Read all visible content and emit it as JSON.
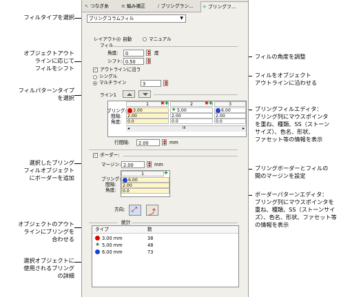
{
  "tabs": [
    {
      "label": "つなぎ糸",
      "icon": "connector-icon"
    },
    {
      "label": "編み補正",
      "icon": "compensation-icon"
    },
    {
      "label": "ブリングラン...",
      "icon": "bling-run-icon"
    },
    {
      "label": "ブリングフ...",
      "icon": "bling-fill-icon",
      "active": true
    }
  ],
  "fill_type": {
    "value": "ブリングコラムフィル"
  },
  "layout": {
    "label": "レイアウト:",
    "auto": "自動",
    "manual": "マニュアル",
    "selected": "auto"
  },
  "fill": {
    "section": "フィル",
    "angle_label": "角度:",
    "angle_value": "0",
    "angle_unit": "度",
    "shift_label": "シフト:",
    "shift_value": "0.50",
    "follow_outline": "アウトラインに沿う",
    "follow_outline_checked": true,
    "single": "シングル",
    "multi": "マルチライン",
    "multi_value": "3",
    "selected": "multi"
  },
  "line1": {
    "section": "ライン1",
    "cols": [
      "1",
      "2",
      "3"
    ],
    "row_labels": {
      "bling": "ブリング:",
      "spacing": "間隔:",
      "angle": "角度:"
    },
    "col1": {
      "bling": "3.00",
      "spacing": "2.00",
      "angle": "0.0"
    },
    "col2": {
      "bling": "5.00",
      "spacing": "2.00",
      "angle": "0.0"
    },
    "col3": {
      "bling": "6.00",
      "spacing": "2.00",
      "angle": "0.0"
    },
    "scroll_mid": "III",
    "row_spacing_label": "行間隔:",
    "row_spacing_value": "2.00",
    "row_spacing_unit": "mm"
  },
  "border": {
    "label": "ボーダー:",
    "checked": true,
    "margin_label": "マージン:",
    "margin_value": "2.00",
    "margin_unit": "mm",
    "col": "1",
    "row_labels": {
      "bling": "ブリング:",
      "spacing": "間隔:",
      "angle": "角度:"
    },
    "bling": "6.00",
    "spacing": "2.00",
    "angle": "0.0",
    "direction_label": "方向:"
  },
  "stats": {
    "section": "統計",
    "col_type": "タイプ",
    "col_count": "数",
    "rows": [
      {
        "type": "3.00 mm",
        "count": "38",
        "color": "#e00000",
        "shape": "circle"
      },
      {
        "type": "5.00 mm",
        "count": "48",
        "color": "#1a8a2a",
        "shape": "star"
      },
      {
        "type": "6.00 mm",
        "count": "73",
        "color": "#1f3fd0",
        "shape": "circle"
      }
    ]
  },
  "callouts": {
    "select_fill_type": "フィルタイプを選択",
    "shift_per_outline": "オブジェクトアウト\nラインに応じて\nフィルをシフト",
    "select_pattern": "フィルパターンタイプ\nを選択",
    "add_border": "選択したブリング\nフィルオブジェクト\nにボーダーを追加",
    "bling_follows": "オブジェクトのアウト\nラインにブリングを\n合わせる",
    "details": "選択オブジェクトに\n使用されるブリング\nの詳細",
    "adjust_angle": "フィルの角度を調整",
    "fill_follow_outline": "フィルをオブジェクト\nアウトラインに沿わせる",
    "fill_editor": "ブリングフィルエディタ：\nブリング列にマウスポインタ\nを重ね、種類、SS（ストーン\nサイズ）、色名、形状、\nファセット等の情報を表示",
    "border_margin": "ブリングボーダーとフィルの\n間のマージンを設定",
    "border_editor": "ボーダーパターンエディタ：\nブリング列にマウスポインタを\n重ね、種類、SS（ストーンサイ\nズ）、色名、形状、ファセット等\nの情報を表示"
  }
}
